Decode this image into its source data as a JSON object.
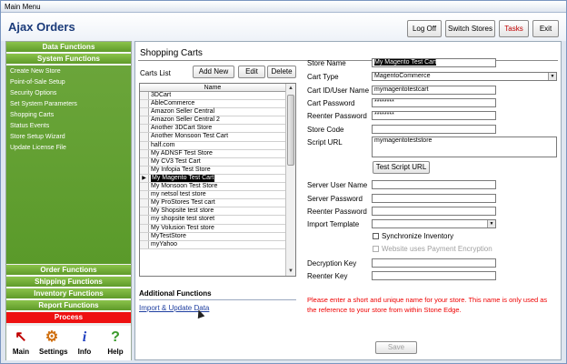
{
  "window": {
    "title": "Main Menu"
  },
  "header": {
    "app_title": "Ajax Orders",
    "buttons": {
      "logoff": "Log Off",
      "switch_stores": "Switch Stores",
      "tasks": "Tasks",
      "exit": "Exit"
    }
  },
  "sidebar": {
    "data_functions": "Data Functions",
    "system_functions": "System Functions",
    "items": [
      "Create New Store",
      "Point-of-Sale Setup",
      "Security Options",
      "Set System Parameters",
      "Shopping Carts",
      "Status Events",
      "Store Setup Wizard",
      "Update License File"
    ],
    "order_functions": "Order Functions",
    "shipping_functions": "Shipping Functions",
    "inventory_functions": "Inventory Functions",
    "report_functions": "Report Functions",
    "process": "Process",
    "tools": [
      {
        "label": "Main",
        "icon": "main-arrow-icon"
      },
      {
        "label": "Settings",
        "icon": "settings-gear-icon"
      },
      {
        "label": "Info",
        "icon": "info-icon"
      },
      {
        "label": "Help",
        "icon": "help-icon"
      }
    ]
  },
  "main": {
    "title": "Shopping Carts",
    "carts_list_label": "Carts List",
    "buttons": {
      "add_new": "Add New",
      "edit": "Edit",
      "delete": "Delete"
    },
    "grid_header": "Name",
    "carts": [
      "3DCart",
      "AbleCommerce",
      "Amazon Seller Central",
      "Amazon Seller Central 2",
      "Another 3DCart Store",
      "Another Monsoon Test Cart",
      "half.com",
      "My ADNSF Test Store",
      "My CV3 Test Cart",
      "My Infopia Test Store",
      "My Magento Test Cart",
      "My Monsoon Test Store",
      "my netsol test store",
      "My ProStores Test cart",
      "My Shopsite test store",
      "my shopsite test storet",
      "My Volusion Test store",
      "MyTestStore",
      "myYahoo"
    ],
    "selected_cart": "My Magento Test Cart",
    "additional_functions": "Additional Functions",
    "import_update_link": "Import & Update Data",
    "form": {
      "store_name_label": "Store Name",
      "store_name": "My Magento Test Cart",
      "cart_type_label": "Cart Type",
      "cart_type": "MagentoCommerce",
      "cart_id_label": "Cart ID/User Name",
      "cart_id": "mymagentotestcart",
      "cart_password_label": "Cart Password",
      "cart_password": "********",
      "reenter_password_label": "Reenter Password",
      "reenter_password": "********",
      "store_code_label": "Store Code",
      "store_code": "",
      "script_url_label": "Script URL",
      "script_url": "mymagentoteststore",
      "test_script_url": "Test Script URL",
      "server_user_label": "Server User Name",
      "server_password_label": "Server Password",
      "reenter_server_password_label": "Reenter Password",
      "import_template_label": "Import Template",
      "sync_inventory_label": "Synchronize Inventory",
      "payment_encryption_label": "Website uses Payment Encryption",
      "decryption_key_label": "Decryption Key",
      "reenter_key_label": "Reenter Key",
      "note": "Please enter a short and unique name for your store. This name is only used as the reference to your store from within Stone Edge.",
      "save": "Save"
    }
  },
  "colors": {
    "accent_green": "#6ba53a",
    "process_red": "#ee1111",
    "header_blue": "#1b3b7a",
    "note_red": "#ee0000"
  }
}
